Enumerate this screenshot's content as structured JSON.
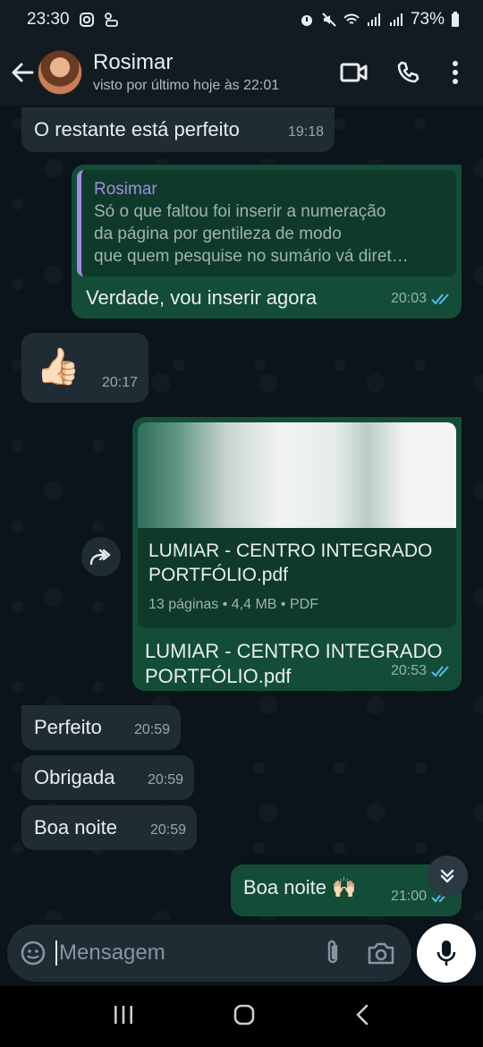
{
  "status_bar": {
    "time": "23:30",
    "battery": "73%"
  },
  "header": {
    "contact_name": "Rosimar",
    "last_seen": "visto por último hoje às 22:01"
  },
  "messages": {
    "m1": {
      "text": "O restante está perfeito",
      "time": "19:18"
    },
    "m2": {
      "quote_author": "Rosimar",
      "quote_lines": [
        "Só o que faltou foi inserir a numeração",
        "da página por gentileza de modo",
        "que quem pesquise no sumário vá diret…"
      ],
      "text": "Verdade, vou inserir agora",
      "time": "20:03"
    },
    "m3": {
      "emoji": "👍🏻",
      "time": "20:17"
    },
    "m4": {
      "doc_name_line1": "LUMIAR - CENTRO INTEGRADO",
      "doc_name_line2": "PORTFÓLIO.pdf",
      "doc_meta": "13 páginas • 4,4 MB • PDF",
      "caption_line1": "LUMIAR - CENTRO INTEGRADO",
      "caption_line2": "PORTFÓLIO.pdf",
      "time": "20:53"
    },
    "m5": {
      "text": "Perfeito",
      "time": "20:59"
    },
    "m6": {
      "text": "Obrigada",
      "time": "20:59"
    },
    "m7": {
      "text": "Boa noite",
      "time": "20:59"
    },
    "m8": {
      "text": "Boa noite 🙌🏻",
      "time": "21:00"
    }
  },
  "input": {
    "placeholder": "Mensagem"
  },
  "colors": {
    "background": "#0b141a",
    "incoming": "#202c33",
    "outgoing": "#134d37",
    "read_ticks": "#53bdeb",
    "quote_accent": "#a48be3"
  },
  "icons": [
    "back-arrow-icon",
    "video-call-icon",
    "phone-icon",
    "menu-dots-icon",
    "forward-icon",
    "scroll-down-icon",
    "sticker-icon",
    "attach-icon",
    "camera-icon",
    "mic-icon"
  ]
}
